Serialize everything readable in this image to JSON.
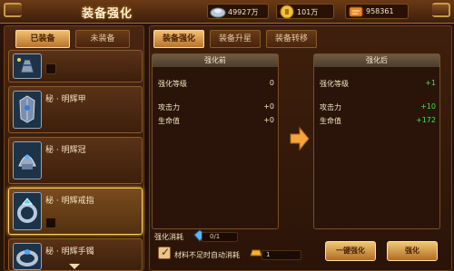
{
  "header": {
    "title": "装备强化",
    "resources": [
      {
        "name": "silver",
        "icon": "silver-ingot-icon",
        "value": "49927万"
      },
      {
        "name": "gold",
        "icon": "gold-coin-icon",
        "value": "101万"
      },
      {
        "name": "ticket",
        "icon": "scroll-ticket-icon",
        "value": "958361"
      }
    ]
  },
  "left": {
    "tabs": [
      {
        "label": "已装备",
        "active": true
      },
      {
        "label": "未装备",
        "active": false
      }
    ],
    "items": [
      {
        "name": "",
        "icon": "gauntlet-icon",
        "selected": false
      },
      {
        "name": "秘 · 明辉甲",
        "icon": "armor-icon",
        "selected": false
      },
      {
        "name": "秘 · 明辉冠",
        "icon": "helmet-icon",
        "selected": false
      },
      {
        "name": "秘 · 明辉戒指",
        "icon": "ring-icon",
        "selected": true
      },
      {
        "name": "秘 · 明辉手镯",
        "icon": "bracelet-icon",
        "selected": false
      }
    ]
  },
  "right": {
    "tabs": [
      {
        "label": "装备强化",
        "active": true
      },
      {
        "label": "装备升星",
        "active": false
      },
      {
        "label": "装备转移",
        "active": false
      }
    ],
    "before": {
      "title": "强化前",
      "rows": [
        {
          "label": "强化等级",
          "value": "0"
        },
        {
          "label": "攻击力",
          "value": "+0"
        },
        {
          "label": "生命值",
          "value": "+0"
        }
      ]
    },
    "after": {
      "title": "强化后",
      "rows": [
        {
          "label": "强化等级",
          "value": "+1"
        },
        {
          "label": "攻击力",
          "value": "+10"
        },
        {
          "label": "生命值",
          "value": "+172"
        }
      ]
    },
    "consume": {
      "label": "强化消耗",
      "gem_count": "0/1",
      "auto_label": "材料不足时自动消耗",
      "auto_checked": true,
      "gold_cost": "1"
    },
    "buttons": {
      "one_key": "一键强化",
      "enhance": "强化"
    }
  },
  "colors": {
    "accent": "#f0c774",
    "highlight": "#ffd46b",
    "green": "#46e04a"
  }
}
